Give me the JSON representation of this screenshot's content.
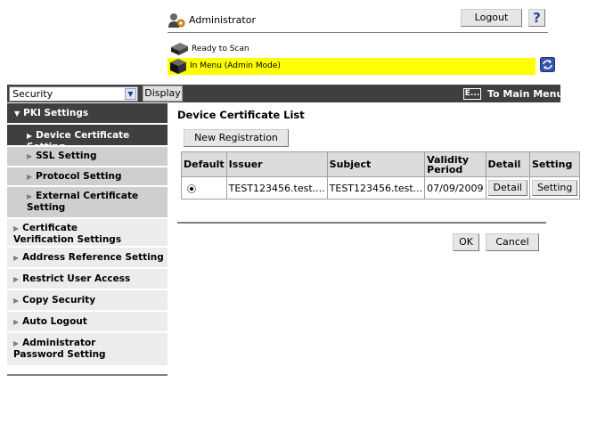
{
  "header": {
    "user_label": "Administrator",
    "logout_label": "Logout",
    "help_label": "?",
    "status_ready": "Ready to Scan",
    "status_mode": "In Menu (Admin Mode)"
  },
  "toolbar": {
    "selected_category": "Security",
    "display_label": "Display",
    "to_main_menu_label": "To Main Menu"
  },
  "sidebar": {
    "pki": {
      "label": "PKI Settings",
      "sub_items": [
        {
          "label": "Device Certificate Setting"
        },
        {
          "label": "SSL Setting"
        },
        {
          "label": "Protocol Setting"
        },
        {
          "label": "External Certificate Setting"
        }
      ]
    },
    "items": [
      {
        "label": "Certificate Verification Settings"
      },
      {
        "label": "Address Reference Setting"
      },
      {
        "label": "Restrict User Access"
      },
      {
        "label": "Copy Security"
      },
      {
        "label": "Auto Logout"
      },
      {
        "label": "Administrator Password Setting"
      }
    ]
  },
  "main": {
    "title": "Device Certificate List",
    "new_registration_label": "New Registration",
    "table": {
      "headers": [
        "Default",
        "Issuer",
        "Subject",
        "Validity Period",
        "Detail",
        "Setting"
      ],
      "rows": [
        {
          "issuer": "TEST123456.test....",
          "subject": "TEST123456.test...",
          "validity": "07/09/2009",
          "detail_label": "Detail",
          "setting_label": "Setting"
        }
      ]
    },
    "ok_label": "OK",
    "cancel_label": "Cancel"
  },
  "colors": {
    "dark_bar": "#3f3f3f",
    "mode_highlight": "#ffff00",
    "sub_item_bg": "#cfcfcf",
    "main_item_bg": "#ececec"
  }
}
